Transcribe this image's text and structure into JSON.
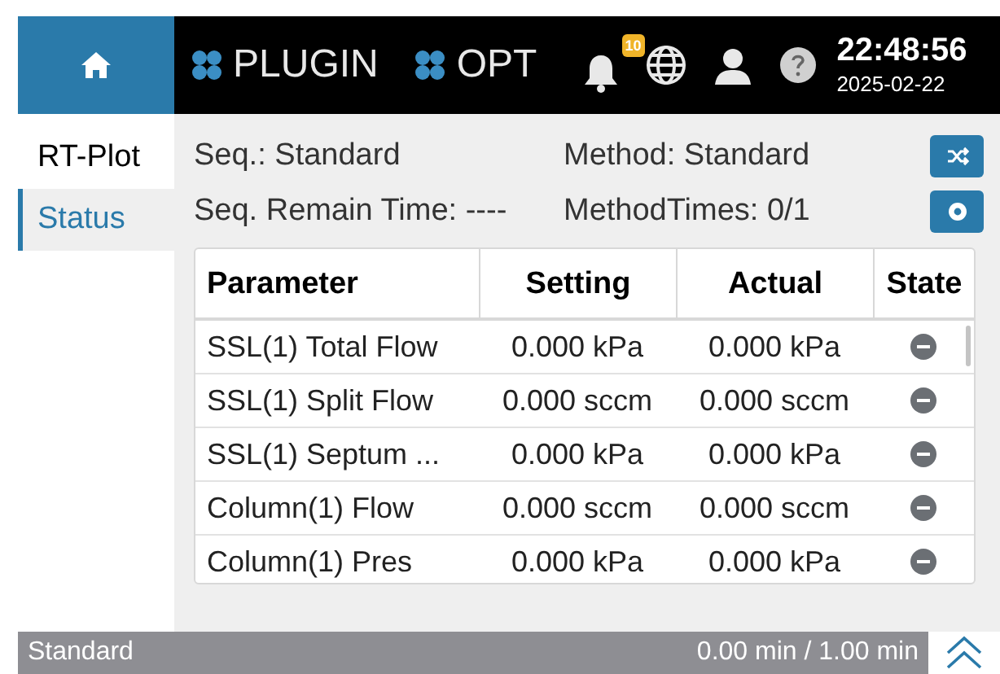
{
  "header": {
    "plugin_label": "PLUGIN",
    "opt_label": "OPT",
    "notification_count": "10",
    "time": "22:48:56",
    "date": "2025-02-22"
  },
  "tabs": [
    {
      "label": "RT-Plot",
      "selected": false
    },
    {
      "label": "Status",
      "selected": true
    }
  ],
  "info": {
    "seq": "Seq.: Standard",
    "method": "Method: Standard",
    "remain": "Seq. Remain Time: ----",
    "method_times": "MethodTimes: 0/1"
  },
  "table": {
    "columns": [
      "Parameter",
      "Setting",
      "Actual",
      "State"
    ],
    "rows": [
      {
        "parameter": "SSL(1) Total Flow",
        "setting": "0.000 kPa",
        "actual": "0.000 kPa"
      },
      {
        "parameter": "SSL(1) Split Flow",
        "setting": "0.000 sccm",
        "actual": "0.000 sccm"
      },
      {
        "parameter": "SSL(1) Septum ...",
        "setting": "0.000 kPa",
        "actual": "0.000 kPa"
      },
      {
        "parameter": "Column(1) Flow",
        "setting": "0.000 sccm",
        "actual": "0.000 sccm"
      },
      {
        "parameter": "Column(1) Pres",
        "setting": "0.000 kPa",
        "actual": "0.000 kPa"
      }
    ]
  },
  "status_bar": {
    "name": "Standard",
    "progress": "0.00 min / 1.00 min"
  }
}
